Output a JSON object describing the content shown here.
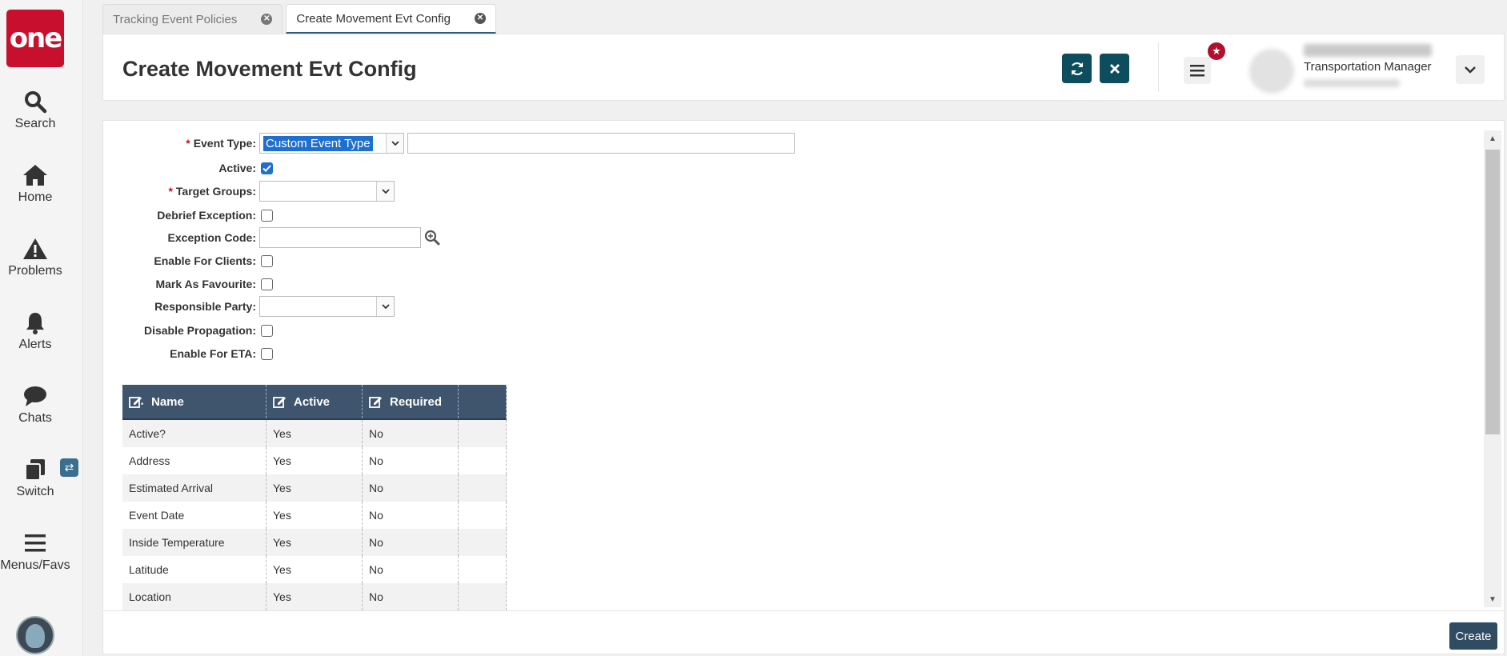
{
  "sidebar": {
    "logo_text": "one",
    "items": [
      {
        "label": "Search",
        "icon": "search-icon"
      },
      {
        "label": "Home",
        "icon": "home-icon"
      },
      {
        "label": "Problems",
        "icon": "warning-icon"
      },
      {
        "label": "Alerts",
        "icon": "bell-icon"
      },
      {
        "label": "Chats",
        "icon": "chat-icon"
      },
      {
        "label": "Switch",
        "icon": "switch-icon"
      },
      {
        "label": "Menus/Favs",
        "icon": "menu-icon"
      }
    ]
  },
  "tabs": [
    {
      "label": "Tracking Event Policies",
      "active": false
    },
    {
      "label": "Create Movement Evt Config",
      "active": true
    }
  ],
  "header": {
    "title": "Create Movement Evt Config",
    "user_role": "Transportation Manager"
  },
  "form": {
    "event_type": {
      "label": "Event Type:",
      "value": "Custom Event Type"
    },
    "active": {
      "label": "Active:",
      "checked": true
    },
    "target_groups": {
      "label": "Target Groups:"
    },
    "debrief_exception": {
      "label": "Debrief Exception:"
    },
    "exception_code": {
      "label": "Exception Code:"
    },
    "enable_for_clients": {
      "label": "Enable For Clients:"
    },
    "mark_as_favourite": {
      "label": "Mark As Favourite:"
    },
    "responsible_party": {
      "label": "Responsible Party:"
    },
    "disable_propagation": {
      "label": "Disable Propagation:"
    },
    "enable_for_eta": {
      "label": "Enable For ETA:"
    },
    "required_marker": "*"
  },
  "grid": {
    "columns": [
      "Name",
      "Active",
      "Required"
    ],
    "rows": [
      [
        "Active?",
        "Yes",
        "No"
      ],
      [
        "Address",
        "Yes",
        "No"
      ],
      [
        "Estimated Arrival",
        "Yes",
        "No"
      ],
      [
        "Event Date",
        "Yes",
        "No"
      ],
      [
        "Inside Temperature",
        "Yes",
        "No"
      ],
      [
        "Latitude",
        "Yes",
        "No"
      ],
      [
        "Location",
        "Yes",
        "No"
      ]
    ]
  },
  "footer": {
    "create_label": "Create"
  },
  "colors": {
    "brand": "#c8102e",
    "header_button": "#0e4d5e",
    "grid_header": "#3f556e"
  }
}
